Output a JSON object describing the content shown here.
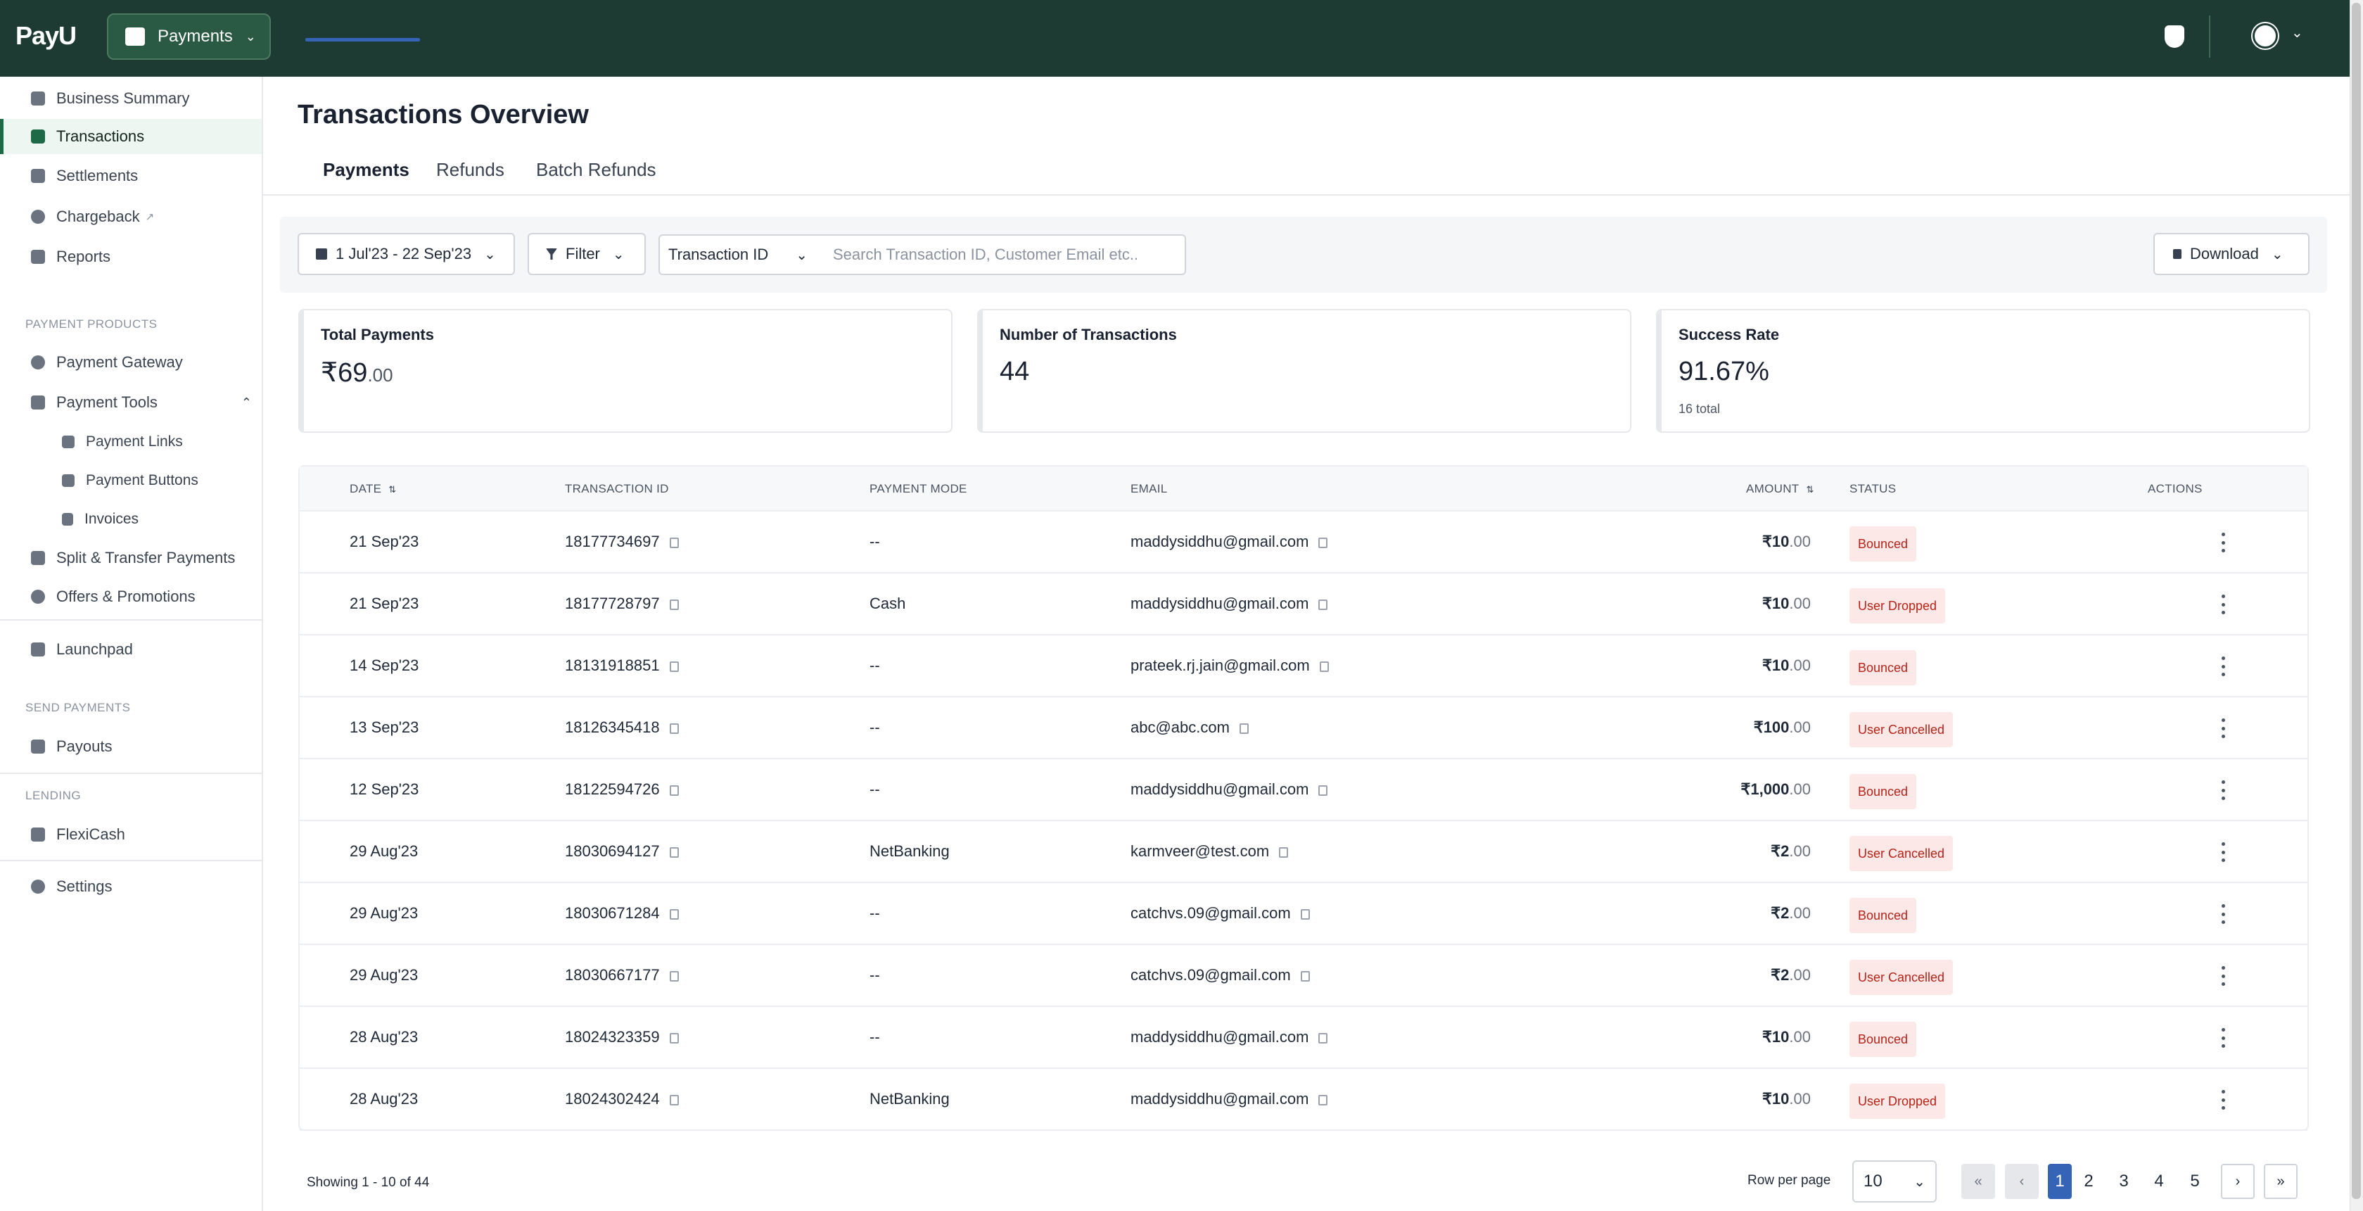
{
  "header": {
    "logo": "PayU",
    "product_switch": "Payments",
    "icons": [
      "shield-icon",
      "avatar-icon",
      "chevron-down-icon"
    ]
  },
  "sidebar": {
    "items_top": [
      {
        "label": "Business Summary",
        "icon": "business-icon"
      },
      {
        "label": "Transactions",
        "icon": "transactions-icon",
        "active": true
      },
      {
        "label": "Settlements",
        "icon": "bank-icon"
      },
      {
        "label": "Chargeback",
        "icon": "chargeback-icon",
        "external": true
      },
      {
        "label": "Reports",
        "icon": "reports-icon"
      }
    ],
    "section_payment_products": "PAYMENT PRODUCTS",
    "items_products": [
      {
        "label": "Payment Gateway",
        "icon": "gateway-icon"
      },
      {
        "label": "Payment Tools",
        "icon": "tools-icon",
        "expanded": true
      },
      {
        "label": "Payment Links",
        "icon": "link-icon"
      },
      {
        "label": "Payment Buttons",
        "icon": "button-icon"
      },
      {
        "label": "Invoices",
        "icon": "invoice-icon"
      },
      {
        "label": "Split & Transfer Payments",
        "icon": "split-icon"
      },
      {
        "label": "Offers & Promotions",
        "icon": "offers-icon"
      }
    ],
    "launchpad": "Launchpad",
    "section_send_payments": "SEND PAYMENTS",
    "payouts": "Payouts",
    "section_lending": "LENDING",
    "flexicash": "FlexiCash",
    "settings": "Settings"
  },
  "main": {
    "title": "Transactions Overview",
    "tabs": [
      "Payments",
      "Refunds",
      "Batch Refunds"
    ],
    "date_range": "1 Jul'23 - 22 Sep'23",
    "filter": "Filter",
    "search_type": "Transaction ID",
    "search_placeholder": "Search Transaction ID, Customer Email etc..",
    "download": "Download",
    "cards": {
      "total_payments_label": "Total Payments",
      "total_payments_value": "₹69",
      "total_payments_decimal": ".00",
      "num_transactions_label": "Number of Transactions",
      "num_transactions_value": "44",
      "success_rate_label": "Success Rate",
      "success_rate_value": "91.67%",
      "success_rate_sub": "16 total"
    },
    "table": {
      "headers": {
        "date": "DATE",
        "transaction_id": "TRANSACTION ID",
        "payment_mode": "PAYMENT MODE",
        "email": "EMAIL",
        "amount": "AMOUNT",
        "status": "STATUS",
        "actions": "ACTIONS"
      },
      "rows": [
        {
          "date": "21 Sep'23",
          "txn": "18177734697",
          "mode": "--",
          "email": "maddysiddhu@gmail.com",
          "amount": "₹10",
          "dec": ".00",
          "status": "Bounced"
        },
        {
          "date": "21 Sep'23",
          "txn": "18177728797",
          "mode": "Cash",
          "email": "maddysiddhu@gmail.com",
          "amount": "₹10",
          "dec": ".00",
          "status": "User Dropped"
        },
        {
          "date": "14 Sep'23",
          "txn": "18131918851",
          "mode": "--",
          "email": "prateek.rj.jain@gmail.com",
          "amount": "₹10",
          "dec": ".00",
          "status": "Bounced"
        },
        {
          "date": "13 Sep'23",
          "txn": "18126345418",
          "mode": "--",
          "email": "abc@abc.com",
          "amount": "₹100",
          "dec": ".00",
          "status": "User Cancelled"
        },
        {
          "date": "12 Sep'23",
          "txn": "18122594726",
          "mode": "--",
          "email": "maddysiddhu@gmail.com",
          "amount": "₹1,000",
          "dec": ".00",
          "status": "Bounced"
        },
        {
          "date": "29 Aug'23",
          "txn": "18030694127",
          "mode": "NetBanking",
          "email": "karmveer@test.com",
          "amount": "₹2",
          "dec": ".00",
          "status": "User Cancelled"
        },
        {
          "date": "29 Aug'23",
          "txn": "18030671284",
          "mode": "--",
          "email": "catchvs.09@gmail.com",
          "amount": "₹2",
          "dec": ".00",
          "status": "Bounced"
        },
        {
          "date": "29 Aug'23",
          "txn": "18030667177",
          "mode": "--",
          "email": "catchvs.09@gmail.com",
          "amount": "₹2",
          "dec": ".00",
          "status": "User Cancelled"
        },
        {
          "date": "28 Aug'23",
          "txn": "18024323359",
          "mode": "--",
          "email": "maddysiddhu@gmail.com",
          "amount": "₹10",
          "dec": ".00",
          "status": "Bounced"
        },
        {
          "date": "28 Aug'23",
          "txn": "18024302424",
          "mode": "NetBanking",
          "email": "maddysiddhu@gmail.com",
          "amount": "₹10",
          "dec": ".00",
          "status": "User Dropped"
        }
      ]
    },
    "pagination": {
      "showing": "Showing 1 - 10 of 44",
      "rows_per_page_label": "Row per page",
      "rows_per_page_value": "10",
      "first": "«",
      "prev": "‹",
      "pages": [
        "1",
        "2",
        "3",
        "4",
        "5"
      ],
      "current": "1",
      "next": "›",
      "last": "»"
    }
  },
  "colors": {
    "header_bg": "#1d3b32",
    "accent": "#3563b5",
    "badge_bg": "#fde8e8",
    "badge_text": "#b42318"
  }
}
